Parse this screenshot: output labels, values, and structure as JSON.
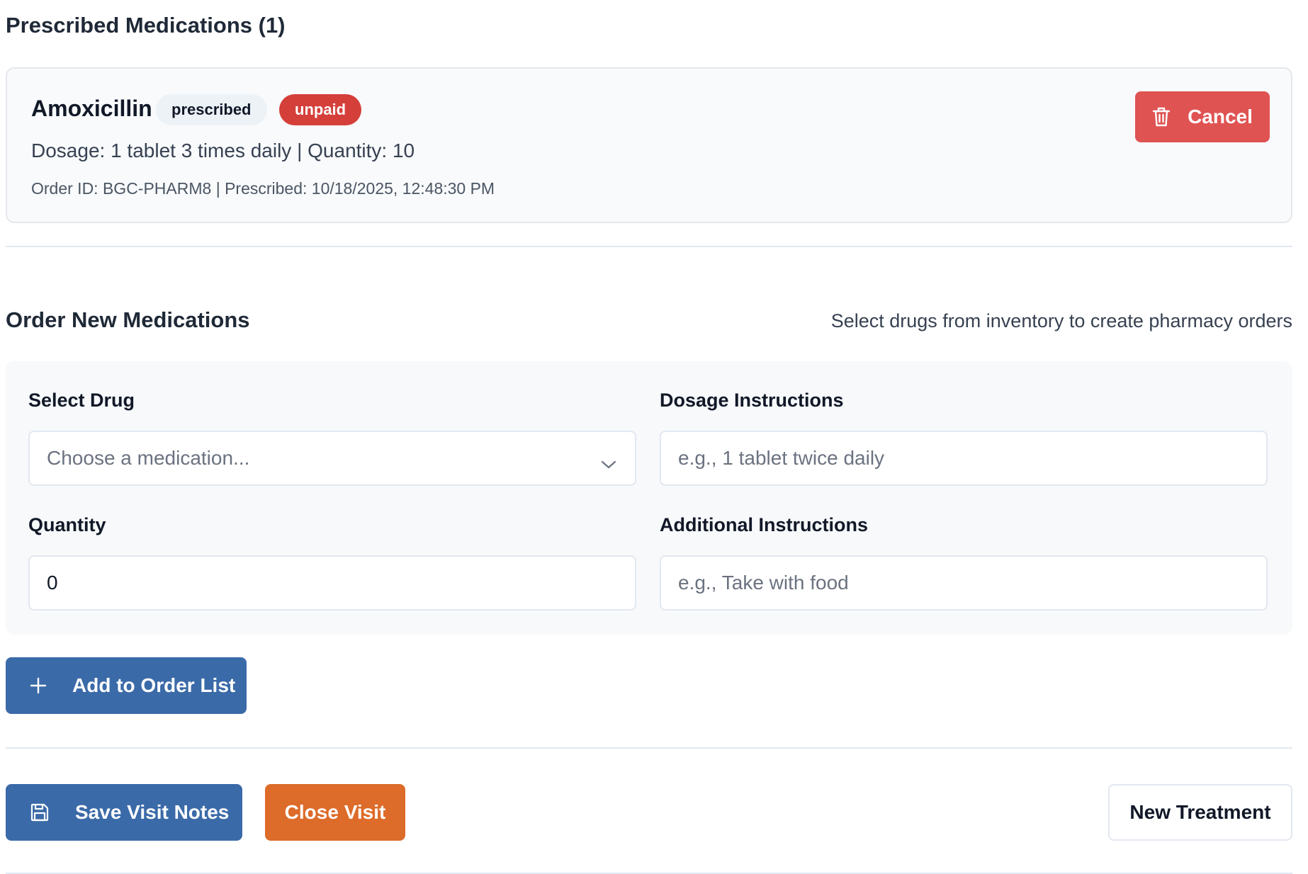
{
  "prescribed": {
    "title": "Prescribed Medications (1)",
    "items": [
      {
        "name": "Amoxicillin",
        "status_badge": "prescribed",
        "payment_badge": "unpaid",
        "dosage_line": "Dosage: 1 tablet 3 times daily | Quantity: 10",
        "meta_line": "Order ID: BGC-PHARM8 | Prescribed: 10/18/2025, 12:48:30 PM",
        "cancel_label": "Cancel"
      }
    ]
  },
  "order": {
    "title": "Order New Medications",
    "hint": "Select drugs from inventory to create pharmacy orders",
    "drug": {
      "label": "Select Drug",
      "placeholder": "Choose a medication..."
    },
    "dosage": {
      "label": "Dosage Instructions",
      "placeholder": "e.g., 1 tablet twice daily"
    },
    "quantity": {
      "label": "Quantity",
      "value": "0"
    },
    "additional": {
      "label": "Additional Instructions",
      "placeholder": "e.g., Take with food"
    },
    "add_label": "Add to Order List"
  },
  "actions": {
    "save_label": "Save Visit Notes",
    "close_label": "Close Visit",
    "new_label": "New Treatment"
  },
  "colors": {
    "primary": "#3b6aa8",
    "danger": "#e05353",
    "unpaid_badge": "#d53f3a",
    "close_visit": "#dd6b2a"
  },
  "icons": {
    "cancel": "trash-icon",
    "add": "plus-icon",
    "save": "save-icon",
    "select": "chevron-down-icon"
  }
}
